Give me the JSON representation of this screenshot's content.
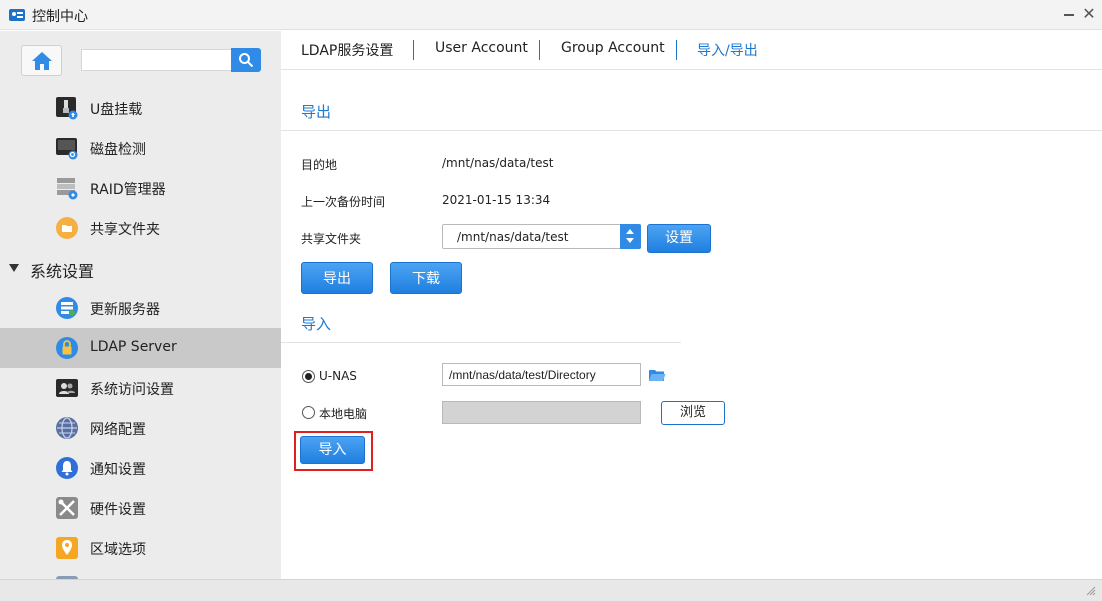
{
  "window": {
    "title": "控制中心"
  },
  "sidebar": {
    "search_placeholder": "",
    "items_top": [
      {
        "label": "U盘挂载",
        "icon": "usb-drive-icon"
      },
      {
        "label": "磁盘检测",
        "icon": "disk-check-icon"
      },
      {
        "label": "RAID管理器",
        "icon": "raid-manager-icon"
      },
      {
        "label": "共享文件夹",
        "icon": "shared-folder-icon"
      }
    ],
    "section": {
      "label": "系统设置"
    },
    "items_system": [
      {
        "label": "更新服务器",
        "icon": "update-server-icon"
      },
      {
        "label": "LDAP Server",
        "icon": "ldap-lock-icon",
        "active": true
      },
      {
        "label": "系统访问设置",
        "icon": "system-access-icon"
      },
      {
        "label": "网络配置",
        "icon": "network-globe-icon"
      },
      {
        "label": "通知设置",
        "icon": "notification-bell-icon"
      },
      {
        "label": "硬件设置",
        "icon": "hardware-tools-icon"
      },
      {
        "label": "区域选项",
        "icon": "region-pin-icon"
      }
    ]
  },
  "tabs": [
    {
      "label": "LDAP服务设置",
      "active": false
    },
    {
      "label": "User Account",
      "active": false
    },
    {
      "label": "Group Account",
      "active": false
    },
    {
      "label": "导入/导出",
      "active": true
    }
  ],
  "export": {
    "title": "导出",
    "destination_label": "目的地",
    "destination_value": "/mnt/nas/data/test",
    "last_backup_label": "上一次备份时间",
    "last_backup_value": "2021-01-15 13:34",
    "shared_folder_label": "共享文件夹",
    "shared_folder_value": "/mnt/nas/data/test",
    "set_button": "设置",
    "export_button": "导出",
    "download_button": "下载"
  },
  "import": {
    "title": "导入",
    "unas_label": "U-NAS",
    "unas_path": "/mnt/nas/data/test/Directory",
    "local_label": "本地电脑",
    "local_path": "",
    "browse_button": "浏览",
    "import_button": "导入",
    "selected_source": "U-NAS"
  },
  "colors": {
    "accent": "#1d78d2",
    "button": "#2f8be6",
    "highlight": "#e02020",
    "sidebar_bg": "#ececec",
    "sidebar_active": "#c9c9c9"
  }
}
